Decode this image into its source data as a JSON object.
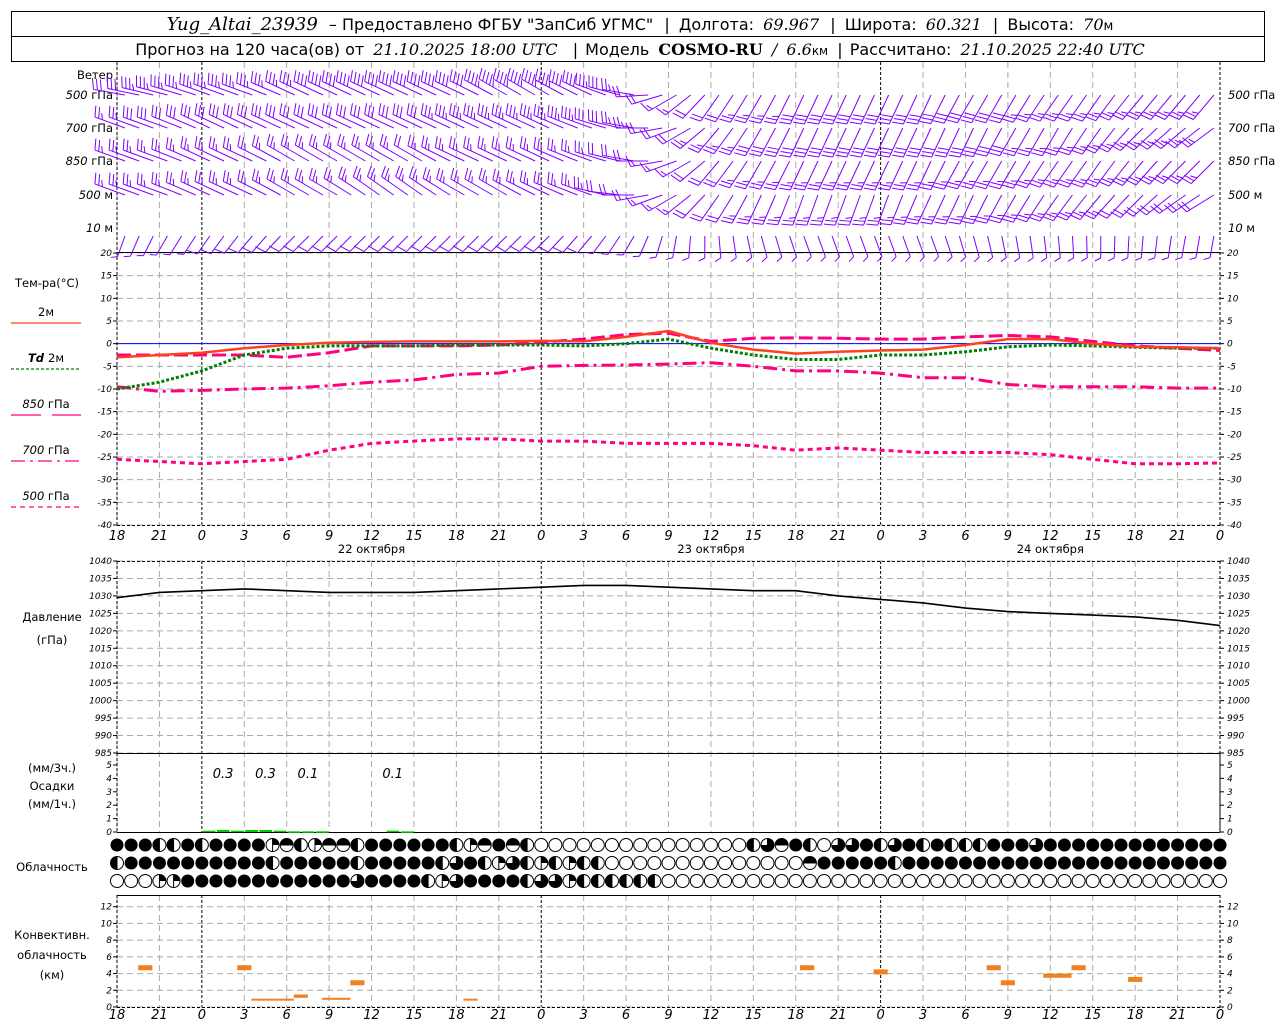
{
  "header": {
    "station": "Yug_Altai_23939",
    "provider": "– Предоставлено ФГБУ \"ЗапСиб УГМС\"",
    "lon_label": "Долгота:",
    "lon": "69.967",
    "lat_label": "Широта:",
    "lat": "60.321",
    "alt_label": "Высота:",
    "alt": "70",
    "alt_unit": "м",
    "forecast_prefix": "Прогноз на 120 часа(ов) от",
    "forecast_time": "21.10.2025 18:00 UTC",
    "model_label": "Модель",
    "model": "COSMO-RU",
    "model_sep": "/",
    "resolution": "6.6",
    "res_unit": "км",
    "calc_label": "Рассчитано:",
    "calc_time": "21.10.2025 22:40 UTC"
  },
  "time_axis": {
    "labels": [
      "18",
      "21",
      "0",
      "3",
      "6",
      "9",
      "12",
      "15",
      "18",
      "21",
      "0",
      "3",
      "6",
      "9",
      "12",
      "15",
      "18",
      "21",
      "0",
      "3",
      "6",
      "9",
      "12",
      "15",
      "18",
      "21",
      "0"
    ],
    "dates": [
      "22 октября",
      "23 октября",
      "24 октября"
    ]
  },
  "wind": {
    "title": "Ветер",
    "color": "#8000ff",
    "levels": [
      {
        "num": "500",
        "unit": "гПа",
        "dir": [
          280,
          285,
          290,
          290,
          295,
          295,
          295,
          295,
          295,
          300,
          300,
          295,
          280,
          240,
          215,
          210,
          205,
          205,
          205,
          205,
          210,
          210,
          215,
          215,
          220,
          220,
          220
        ],
        "speed": [
          15,
          17,
          18,
          18,
          18,
          20,
          20,
          20,
          20,
          22,
          22,
          20,
          12,
          8,
          10,
          12,
          14,
          14,
          14,
          14,
          14,
          14,
          12,
          12,
          12,
          12,
          12
        ]
      },
      {
        "num": "700",
        "unit": "гПа",
        "dir": [
          290,
          290,
          295,
          295,
          295,
          295,
          295,
          295,
          295,
          295,
          295,
          290,
          280,
          250,
          220,
          210,
          205,
          205,
          205,
          205,
          205,
          210,
          210,
          215,
          225,
          230,
          235
        ],
        "speed": [
          12,
          15,
          15,
          15,
          15,
          15,
          15,
          15,
          17,
          18,
          18,
          18,
          12,
          10,
          12,
          14,
          14,
          14,
          15,
          15,
          14,
          14,
          12,
          12,
          12,
          12,
          12
        ]
      },
      {
        "num": "850",
        "unit": "гПа",
        "dir": [
          290,
          290,
          295,
          295,
          300,
          300,
          300,
          300,
          295,
          295,
          295,
          290,
          280,
          250,
          220,
          210,
          205,
          205,
          205,
          205,
          210,
          210,
          215,
          215,
          220,
          225,
          225
        ],
        "speed": [
          12,
          13,
          13,
          13,
          13,
          12,
          12,
          11,
          12,
          13,
          13,
          13,
          10,
          8,
          10,
          12,
          12,
          12,
          12,
          12,
          12,
          12,
          12,
          12,
          12,
          12,
          12
        ]
      },
      {
        "num": "500",
        "unit": "м",
        "dir": [
          290,
          290,
          295,
          295,
          300,
          300,
          305,
          305,
          300,
          300,
          295,
          290,
          270,
          240,
          215,
          205,
          200,
          200,
          200,
          205,
          205,
          210,
          215,
          220,
          225,
          235,
          240
        ],
        "speed": [
          12,
          12,
          12,
          12,
          12,
          12,
          12,
          12,
          12,
          12,
          12,
          12,
          10,
          8,
          10,
          12,
          12,
          12,
          12,
          12,
          12,
          12,
          12,
          12,
          10,
          10,
          10
        ]
      },
      {
        "num": "10",
        "unit": "м",
        "dir": [
          200,
          210,
          215,
          220,
          225,
          225,
          225,
          225,
          225,
          225,
          225,
          220,
          210,
          190,
          175,
          165,
          160,
          160,
          160,
          160,
          165,
          170,
          175,
          180,
          185,
          190,
          190
        ],
        "speed": [
          3,
          3,
          4,
          4,
          4,
          4,
          4,
          4,
          4,
          4,
          4,
          4,
          3,
          3,
          3,
          3,
          3,
          3,
          3,
          3,
          3,
          3,
          3,
          3,
          3,
          3,
          3
        ]
      }
    ]
  },
  "temperature": {
    "title": "Тем-ра(°С)",
    "yticks": [
      20,
      15,
      10,
      5,
      0,
      -5,
      -10,
      -15,
      -20,
      -25,
      -30,
      -35,
      -40
    ],
    "ylim": [
      -40,
      20
    ],
    "legend": [
      {
        "key": "t2m",
        "num": "",
        "label": "2м",
        "color": "#ff4020",
        "dash": "solid"
      },
      {
        "key": "td2m",
        "num": "Td",
        "label": "2м",
        "color": "#008000",
        "dash": "dotted"
      },
      {
        "key": "t850",
        "num": "850",
        "label": "гПа",
        "color": "#ff0080",
        "dash": "long-dash"
      },
      {
        "key": "t700",
        "num": "700",
        "label": "гПа",
        "color": "#ff0080",
        "dash": "dash-dot"
      },
      {
        "key": "t500",
        "num": "500",
        "label": "гПа",
        "color": "#ff0080",
        "dash": "short-dash"
      }
    ],
    "freezing_line_color": "#0000ff",
    "series": {
      "t2m": [
        -3,
        -2.5,
        -2,
        -1,
        -0.3,
        0.2,
        0.4,
        0.5,
        0.5,
        0.5,
        0.6,
        0.5,
        1.5,
        2.8,
        0.2,
        -1.3,
        -2.2,
        -1.8,
        -1.5,
        -1.3,
        -0.3,
        1,
        1,
        0,
        -0.7,
        -0.8,
        -1
      ],
      "td2m": [
        -10,
        -8.5,
        -6,
        -2.5,
        -1,
        -0.5,
        -0.5,
        -0.5,
        -0.3,
        -0.3,
        -0.3,
        -0.5,
        0,
        1,
        -1,
        -2.5,
        -3.5,
        -3.5,
        -2.5,
        -2.5,
        -1.8,
        -0.7,
        -0.3,
        -0.5,
        -0.8,
        -1,
        -1
      ],
      "t850": [
        -2.5,
        -2.5,
        -2.5,
        -2.5,
        -3,
        -2,
        -0.5,
        -0.5,
        -0.5,
        -0.3,
        0.3,
        1,
        2,
        2.3,
        0.5,
        1.2,
        1.3,
        1.2,
        1,
        1,
        1.5,
        1.8,
        1.5,
        0.5,
        -0.5,
        -1,
        -1.5
      ],
      "t700": [
        -9.5,
        -10.5,
        -10.3,
        -10,
        -9.8,
        -9.3,
        -8.5,
        -8,
        -6.8,
        -6.5,
        -5,
        -4.8,
        -4.7,
        -4.5,
        -4.2,
        -5,
        -6,
        -6,
        -6.5,
        -7.5,
        -7.5,
        -9,
        -9.5,
        -9.5,
        -9.5,
        -9.8,
        -9.8
      ],
      "t500": [
        -25.5,
        -26,
        -26.5,
        -26,
        -25.5,
        -23.5,
        -22,
        -21.5,
        -21,
        -21,
        -21.5,
        -21.5,
        -22,
        -22,
        -22,
        -22.5,
        -23.5,
        -23,
        -23.5,
        -24,
        -24,
        -24,
        -24.5,
        -25.5,
        -26.5,
        -26.5,
        -26.3
      ]
    }
  },
  "pressure": {
    "title": "Давление",
    "unit": "(гПа)",
    "yticks": [
      1040,
      1035,
      1030,
      1025,
      1020,
      1015,
      1010,
      1005,
      1000,
      995,
      990,
      985
    ],
    "ylim": [
      985,
      1040
    ],
    "values": [
      1029.5,
      1031,
      1031.5,
      1032,
      1031.5,
      1031,
      1031,
      1031,
      1031.5,
      1032,
      1032.5,
      1033,
      1033,
      1032.5,
      1032,
      1031.5,
      1031.5,
      1030,
      1029,
      1028,
      1026.5,
      1025.5,
      1025,
      1024.5,
      1024,
      1023,
      1021.5
    ]
  },
  "precipitation": {
    "unit_3h": "(мм/3ч.)",
    "title": "Осадки",
    "unit_1h": "(мм/1ч.)",
    "color": "#00cc00",
    "yticks": [
      5,
      4,
      3,
      2,
      1,
      0
    ],
    "hourly": [
      {
        "hour": 6,
        "mm": 0.1
      },
      {
        "hour": 7,
        "mm": 0.15
      },
      {
        "hour": 8,
        "mm": 0.1
      },
      {
        "hour": 9,
        "mm": 0.15
      },
      {
        "hour": 10,
        "mm": 0.15
      },
      {
        "hour": 11,
        "mm": 0.1
      },
      {
        "hour": 12,
        "mm": 0.05
      },
      {
        "hour": 13,
        "mm": 0.05
      },
      {
        "hour": 14,
        "mm": 0.05
      },
      {
        "hour": 19,
        "mm": 0.1
      },
      {
        "hour": 20,
        "mm": 0.05
      }
    ],
    "sums_3h": [
      {
        "period": 2,
        "text": "0.3"
      },
      {
        "period": 3,
        "text": "0.3"
      },
      {
        "period": 4,
        "text": "0.1"
      },
      {
        "period": 6,
        "text": "0.1"
      }
    ]
  },
  "cloudiness": {
    "title": "Облачность",
    "rows_octas": [
      [
        8,
        8,
        8,
        4,
        4,
        8,
        4,
        8,
        8,
        8,
        8,
        2,
        5,
        4,
        2,
        5,
        5,
        4,
        8,
        8,
        8,
        8,
        8,
        8,
        4,
        2,
        5,
        8,
        5,
        4,
        0,
        0,
        0,
        0,
        0,
        0,
        0,
        0,
        0,
        0,
        0,
        0,
        0,
        0,
        0,
        4,
        6,
        5,
        8,
        4,
        0,
        6,
        6,
        8,
        4,
        6,
        8,
        4,
        8,
        4,
        4,
        4,
        8,
        8,
        8,
        6,
        8,
        8,
        8,
        8,
        8,
        8,
        8,
        8,
        8,
        8,
        8,
        8,
        8
      ],
      [
        4,
        8,
        8,
        8,
        8,
        8,
        8,
        8,
        8,
        8,
        8,
        4,
        8,
        8,
        8,
        8,
        8,
        4,
        8,
        8,
        8,
        8,
        8,
        4,
        6,
        8,
        4,
        2,
        6,
        4,
        2,
        4,
        2,
        4,
        4,
        0,
        0,
        0,
        0,
        0,
        0,
        0,
        0,
        0,
        0,
        0,
        0,
        0,
        0,
        5,
        8,
        8,
        8,
        8,
        8,
        4,
        8,
        8,
        8,
        8,
        8,
        8,
        8,
        8,
        8,
        8,
        8,
        8,
        8,
        8,
        8,
        8,
        8,
        8,
        8,
        8,
        8,
        8,
        8
      ],
      [
        0,
        0,
        0,
        2,
        2,
        8,
        8,
        8,
        8,
        8,
        8,
        8,
        8,
        8,
        8,
        8,
        8,
        6,
        8,
        8,
        8,
        8,
        4,
        2,
        6,
        8,
        8,
        8,
        8,
        4,
        6,
        6,
        2,
        4,
        4,
        4,
        4,
        4,
        4,
        0,
        0,
        0,
        0,
        0,
        0,
        0,
        0,
        0,
        0,
        0,
        0,
        0,
        0,
        0,
        0,
        0,
        0,
        0,
        0,
        0,
        0,
        0,
        0,
        0,
        0,
        0,
        0,
        0,
        0,
        0,
        0,
        0,
        0,
        0,
        0,
        0,
        0,
        0,
        0
      ]
    ]
  },
  "convective": {
    "title_1": "Конвективн.",
    "title_2": "облачность",
    "unit": "(км)",
    "color": "#f08020",
    "yticks": [
      12,
      10,
      8,
      6,
      4,
      2,
      0
    ],
    "ylim": [
      0,
      13.4
    ],
    "cells": [
      {
        "from_h": 1.5,
        "to_h": 2.5,
        "base_km": 4.4,
        "top_km": 5.0
      },
      {
        "from_h": 8.5,
        "to_h": 9.5,
        "base_km": 4.4,
        "top_km": 5.0
      },
      {
        "from_h": 9.5,
        "to_h": 11.5,
        "base_km": 0.8,
        "top_km": 1.0
      },
      {
        "from_h": 11.5,
        "to_h": 12.5,
        "base_km": 0.8,
        "top_km": 1.0
      },
      {
        "from_h": 12.5,
        "to_h": 13.5,
        "base_km": 1.1,
        "top_km": 1.5
      },
      {
        "from_h": 14.5,
        "to_h": 16.5,
        "base_km": 0.9,
        "top_km": 1.1
      },
      {
        "from_h": 16.5,
        "to_h": 17.5,
        "base_km": 2.6,
        "top_km": 3.2
      },
      {
        "from_h": 24.5,
        "to_h": 25.5,
        "base_km": 0.8,
        "top_km": 1.0
      },
      {
        "from_h": 48.3,
        "to_h": 49.3,
        "base_km": 4.4,
        "top_km": 5.0
      },
      {
        "from_h": 53.5,
        "to_h": 54.5,
        "base_km": 3.9,
        "top_km": 4.5
      },
      {
        "from_h": 61.5,
        "to_h": 62.5,
        "base_km": 4.4,
        "top_km": 5.0
      },
      {
        "from_h": 62.5,
        "to_h": 63.5,
        "base_km": 2.6,
        "top_km": 3.2
      },
      {
        "from_h": 65.5,
        "to_h": 67.5,
        "base_km": 3.5,
        "top_km": 4.0
      },
      {
        "from_h": 67.5,
        "to_h": 68.5,
        "base_km": 4.4,
        "top_km": 5.0
      },
      {
        "from_h": 71.5,
        "to_h": 72.5,
        "base_km": 3.0,
        "top_km": 3.6
      }
    ]
  }
}
